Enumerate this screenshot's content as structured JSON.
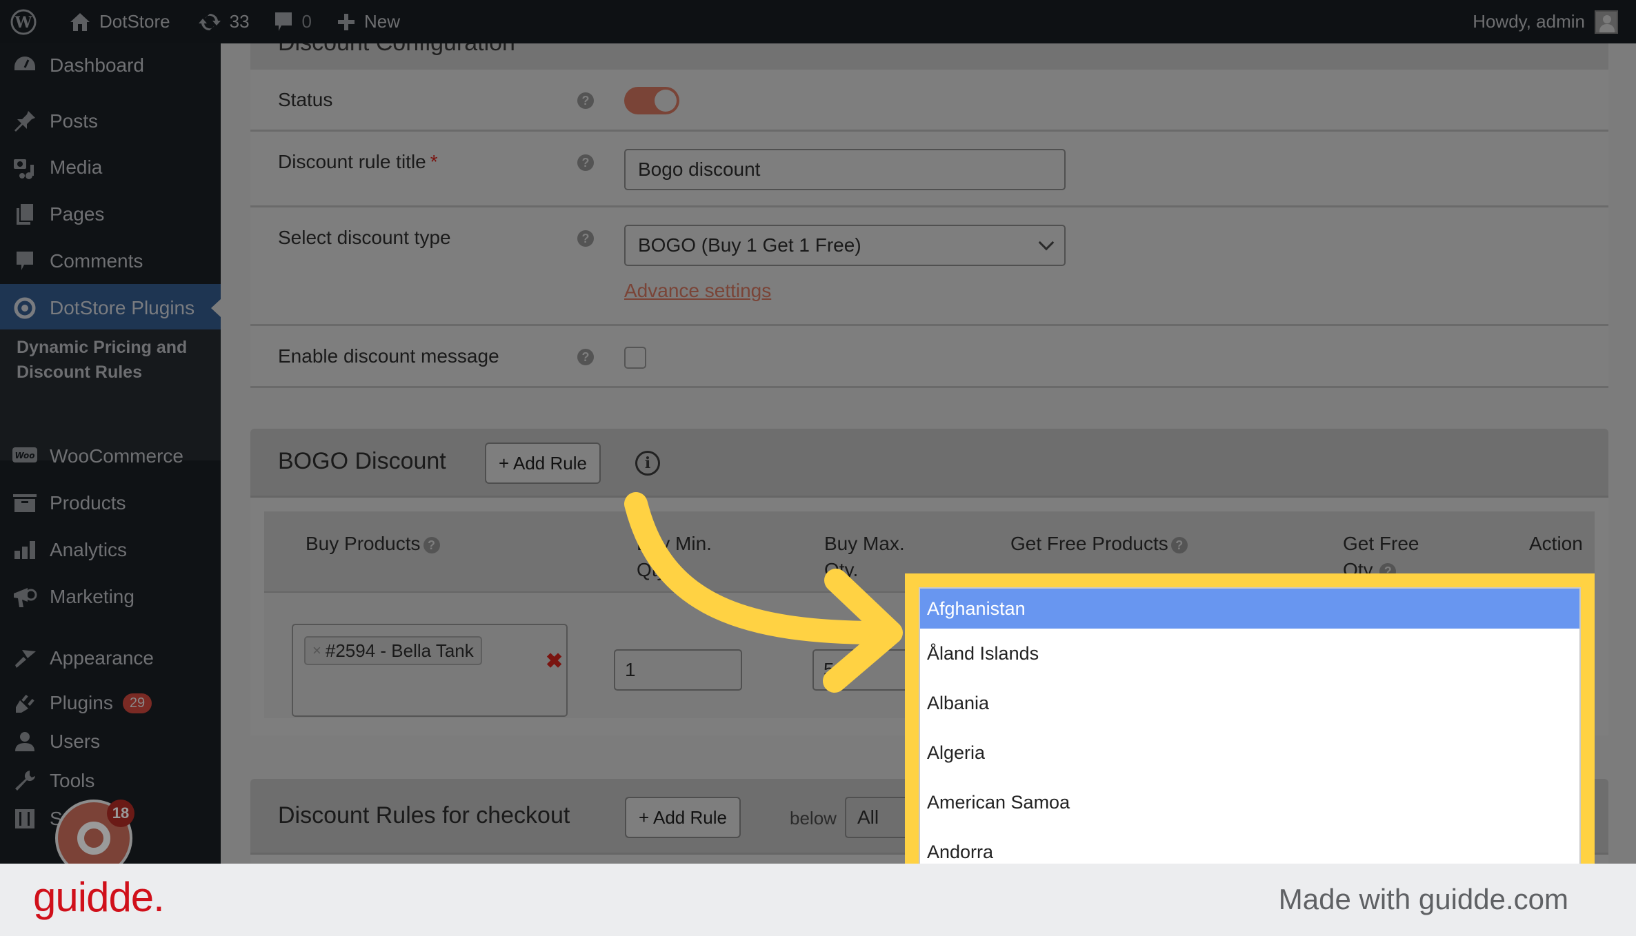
{
  "adminbar": {
    "site_name": "DotStore",
    "updates_count": "33",
    "comments_count": "0",
    "new_label": "New",
    "greeting": "Howdy, admin"
  },
  "sidebar": {
    "items": [
      {
        "label": "Dashboard",
        "icon": "dashboard-icon"
      },
      {
        "label": "Posts",
        "icon": "pin-icon"
      },
      {
        "label": "Media",
        "icon": "media-icon"
      },
      {
        "label": "Pages",
        "icon": "pages-icon"
      },
      {
        "label": "Comments",
        "icon": "comment-icon"
      },
      {
        "label": "DotStore Plugins",
        "icon": "target-icon",
        "active": true
      },
      {
        "label": "WooCommerce",
        "icon": "woo-icon"
      },
      {
        "label": "Products",
        "icon": "box-icon"
      },
      {
        "label": "Analytics",
        "icon": "bar-chart-icon"
      },
      {
        "label": "Marketing",
        "icon": "megaphone-icon"
      },
      {
        "label": "Appearance",
        "icon": "brush-icon"
      },
      {
        "label": "Plugins",
        "icon": "plug-icon",
        "badge": "29"
      },
      {
        "label": "Users",
        "icon": "user-icon"
      },
      {
        "label": "Tools",
        "icon": "wrench-icon"
      },
      {
        "label": "S",
        "icon": "settings-icon"
      }
    ],
    "submenu_label": "Dynamic Pricing and Discount Rules",
    "recorder_badge": "18"
  },
  "config": {
    "section_title": "Discount Configuration",
    "status_label": "Status",
    "status_on": true,
    "title_label": "Discount rule title",
    "title_required": "*",
    "title_value": "Bogo discount",
    "type_label": "Select discount type",
    "type_value": "BOGO (Buy 1 Get 1 Free)",
    "advance_link": "Advance settings",
    "message_label": "Enable discount message",
    "message_checked": false,
    "help_glyph": "?"
  },
  "bogo": {
    "title": "BOGO Discount",
    "add_rule": "+ Add Rule",
    "info_glyph": "i",
    "columns": [
      "Buy Products",
      "Buy Min. Qty.",
      "Buy Max. Qty.",
      "Get Free Products",
      "Get Free Qty.",
      "Action"
    ],
    "col_buy_products": "Buy Products",
    "col_min_1": "Buy Min.",
    "col_min_2": "Qty.",
    "col_max_1": "Buy Max.",
    "col_max_2": "Qty.",
    "col_free_products": "Get Free Products",
    "col_free_qty_1": "Get Free",
    "col_free_qty_2": "Qty.",
    "col_action": "Action",
    "row": {
      "product_tag": "#2594 - Bella Tank",
      "tag_remove": "×",
      "clear": "✖",
      "min_qty": "1",
      "max_qty": "5"
    }
  },
  "checkout": {
    "title": "Discount Rules for checkout",
    "add_rule": "+ Add Rule",
    "below_label": "below",
    "below_value": "All"
  },
  "dropdown": {
    "options": [
      "Afghanistan",
      "Åland Islands",
      "Albania",
      "Algeria",
      "American Samoa",
      "Andorra"
    ],
    "selected": "Afghanistan"
  },
  "colors": {
    "highlight": "#ffd243",
    "selected_option": "#6896f0",
    "brand": "#d0101a"
  },
  "footer": {
    "brand": "guidde.",
    "made_with": "Made with guidde.com"
  }
}
